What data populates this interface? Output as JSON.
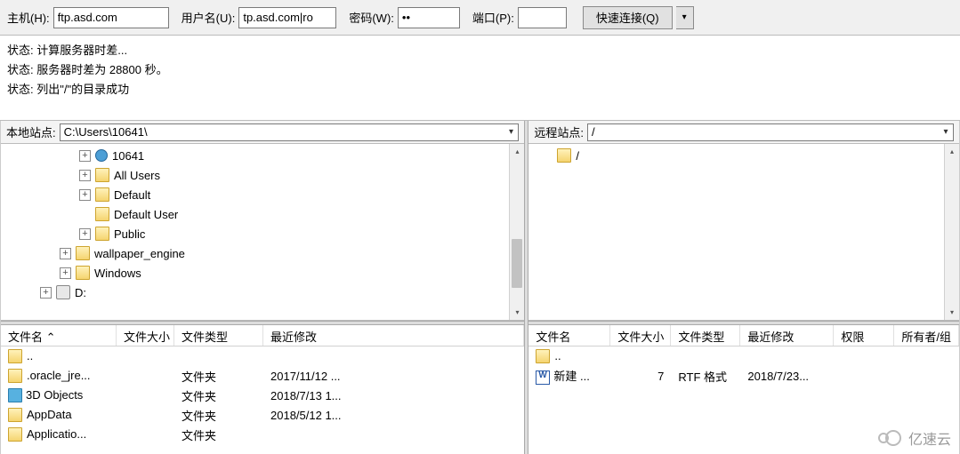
{
  "connect": {
    "host_label": "主机(H):",
    "host_value": "ftp.asd.com",
    "user_label": "用户名(U):",
    "user_value": "tp.asd.com|ro",
    "pass_label": "密码(W):",
    "pass_value": "••",
    "port_label": "端口(P):",
    "port_value": "",
    "quick_btn": "快速连接(Q)"
  },
  "status": [
    "状态:  计算服务器时差...",
    "状态:  服务器时差为 28800 秒。",
    "状态:  列出\"/\"的目录成功"
  ],
  "local": {
    "site_label": "本地站点:",
    "site_value": "C:\\Users\\10641\\",
    "tree": [
      {
        "indent": 4,
        "exp": "+",
        "icon": "user",
        "label": "10641"
      },
      {
        "indent": 4,
        "exp": "+",
        "icon": "folder",
        "label": "All Users"
      },
      {
        "indent": 4,
        "exp": "+",
        "icon": "folder",
        "label": "Default"
      },
      {
        "indent": 4,
        "exp": "",
        "icon": "folder",
        "label": "Default User"
      },
      {
        "indent": 4,
        "exp": "+",
        "icon": "folder",
        "label": "Public"
      },
      {
        "indent": 3,
        "exp": "+",
        "icon": "folder",
        "label": "wallpaper_engine"
      },
      {
        "indent": 3,
        "exp": "+",
        "icon": "folder",
        "label": "Windows"
      },
      {
        "indent": 2,
        "exp": "+",
        "icon": "drive",
        "label": "D:"
      }
    ],
    "list_headers": {
      "name": "文件名 ⌃",
      "size": "文件大小",
      "type": "文件类型",
      "mod": "最近修改"
    },
    "list": [
      {
        "icon": "folder",
        "name": "..",
        "size": "",
        "type": "",
        "mod": ""
      },
      {
        "icon": "folder",
        "name": ".oracle_jre...",
        "size": "",
        "type": "文件夹",
        "mod": "2017/11/12 ..."
      },
      {
        "icon": "3d",
        "name": "3D Objects",
        "size": "",
        "type": "文件夹",
        "mod": "2018/7/13 1..."
      },
      {
        "icon": "folder",
        "name": "AppData",
        "size": "",
        "type": "文件夹",
        "mod": "2018/5/12 1..."
      },
      {
        "icon": "folder",
        "name": "Applicatio...",
        "size": "",
        "type": "文件夹",
        "mod": ""
      }
    ]
  },
  "remote": {
    "site_label": "远程站点:",
    "site_value": "/",
    "tree": [
      {
        "indent": 0,
        "exp": "-",
        "icon": "folder",
        "label": "/"
      }
    ],
    "list_headers": {
      "name": "文件名",
      "size": "文件大小",
      "type": "文件类型",
      "mod": "最近修改",
      "perm": "权限",
      "own": "所有者/组"
    },
    "list": [
      {
        "icon": "folder",
        "name": "..",
        "size": "",
        "type": "",
        "mod": "",
        "perm": "",
        "own": ""
      },
      {
        "icon": "rtf",
        "name": "新建 ...",
        "size": "7",
        "type": "RTF 格式",
        "mod": "2018/7/23...",
        "perm": "",
        "own": ""
      }
    ]
  },
  "watermark": "亿速云"
}
